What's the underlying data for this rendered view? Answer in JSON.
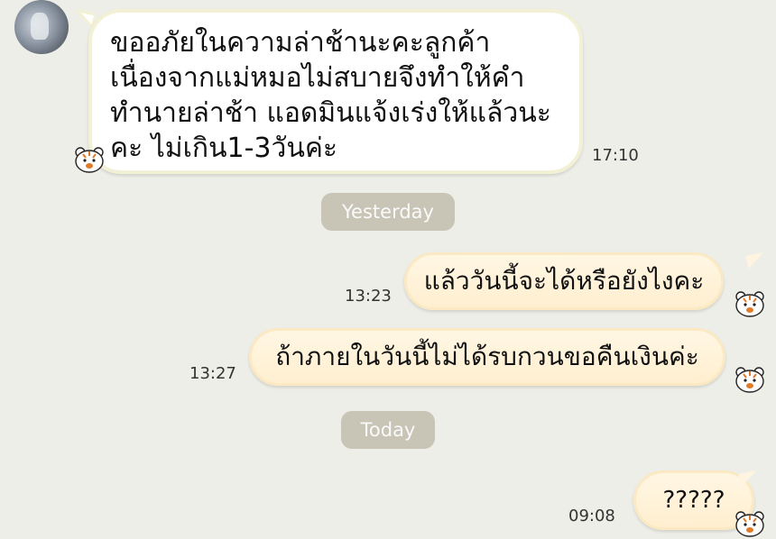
{
  "messages": [
    {
      "direction": "incoming",
      "text": "ขออภัยในความล่าช้านะคะลูกค้า เนื่องจากแม่หมอไม่สบายจึงทำให้คำทำนายล่าช้า แอดมินแจ้งเร่งให้แล้วนะคะ ไม่เกิน1-3วันค่ะ",
      "time": "17:10"
    },
    {
      "direction": "outgoing",
      "text": "แล้ววันนี้จะได้หรือยังไงคะ",
      "time": "13:23"
    },
    {
      "direction": "outgoing",
      "text": "ถ้าภายในวันนี้ไม่ได้รบกวนขอคืนเงินค่ะ",
      "time": "13:27"
    },
    {
      "direction": "outgoing",
      "text": "?????",
      "time": "09:08"
    }
  ],
  "dividers": {
    "yesterday": "Yesterday",
    "today": "Today"
  },
  "colors": {
    "background": "#eeeee8",
    "outgoing_bubble": "#fff2dc",
    "incoming_bubble": "#ffffff",
    "date_pill": "#c8c4b6"
  },
  "icons": {
    "reaction": "tiger-face-icon",
    "avatar": "contact-avatar"
  }
}
